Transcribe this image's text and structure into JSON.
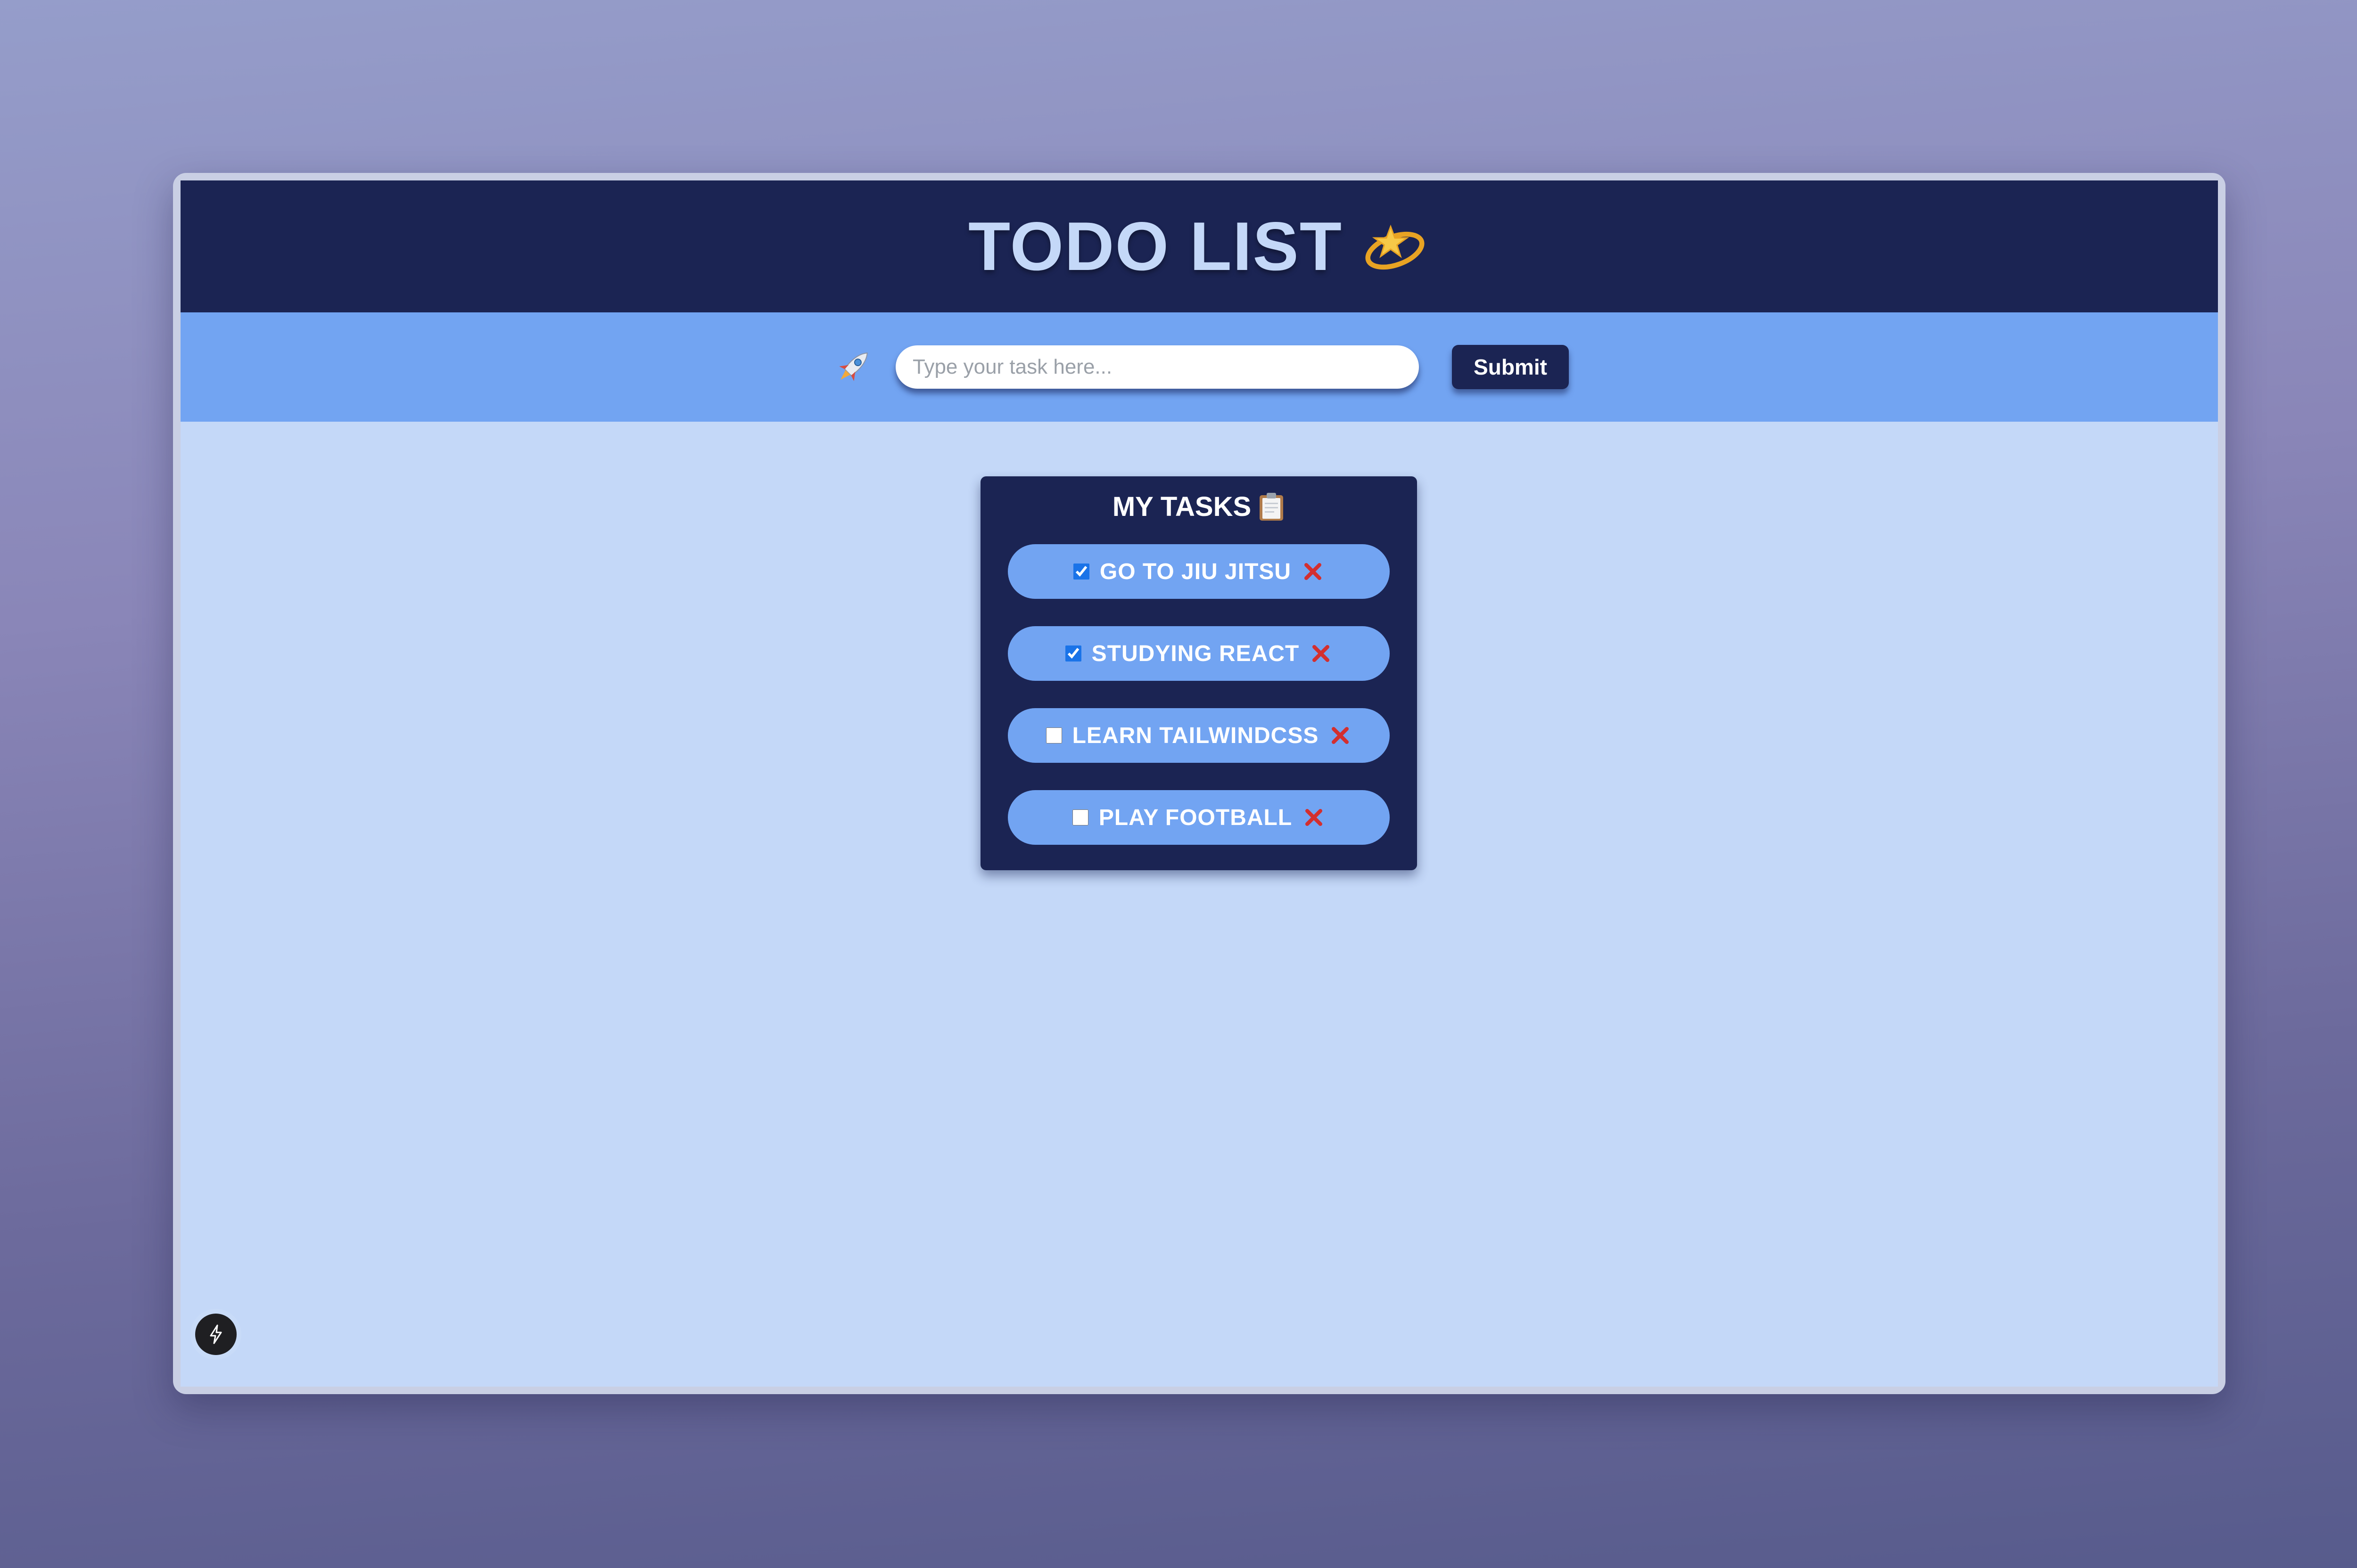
{
  "header": {
    "title": "TODO LIST",
    "title_icon": "dizzy-icon"
  },
  "input_bar": {
    "icon": "rocket-icon",
    "placeholder": "Type your task here...",
    "value": "",
    "submit_label": "Submit"
  },
  "tasks": {
    "heading": "MY TASKS",
    "heading_icon": "clipboard-icon",
    "items": [
      {
        "label": "GO TO JIU JITSU",
        "checked": true
      },
      {
        "label": "STUDYING REACT",
        "checked": true
      },
      {
        "label": "LEARN TAILWINDCSS",
        "checked": false
      },
      {
        "label": "PLAY FOOTBALL",
        "checked": false
      }
    ]
  },
  "badge": {
    "icon": "bolt-icon"
  },
  "colors": {
    "header_bg": "#1b2453",
    "input_bar_bg": "#72a4f2",
    "app_bg": "#c4d8f8",
    "task_pill": "#72a4f2",
    "delete_red": "#d32f2f"
  }
}
